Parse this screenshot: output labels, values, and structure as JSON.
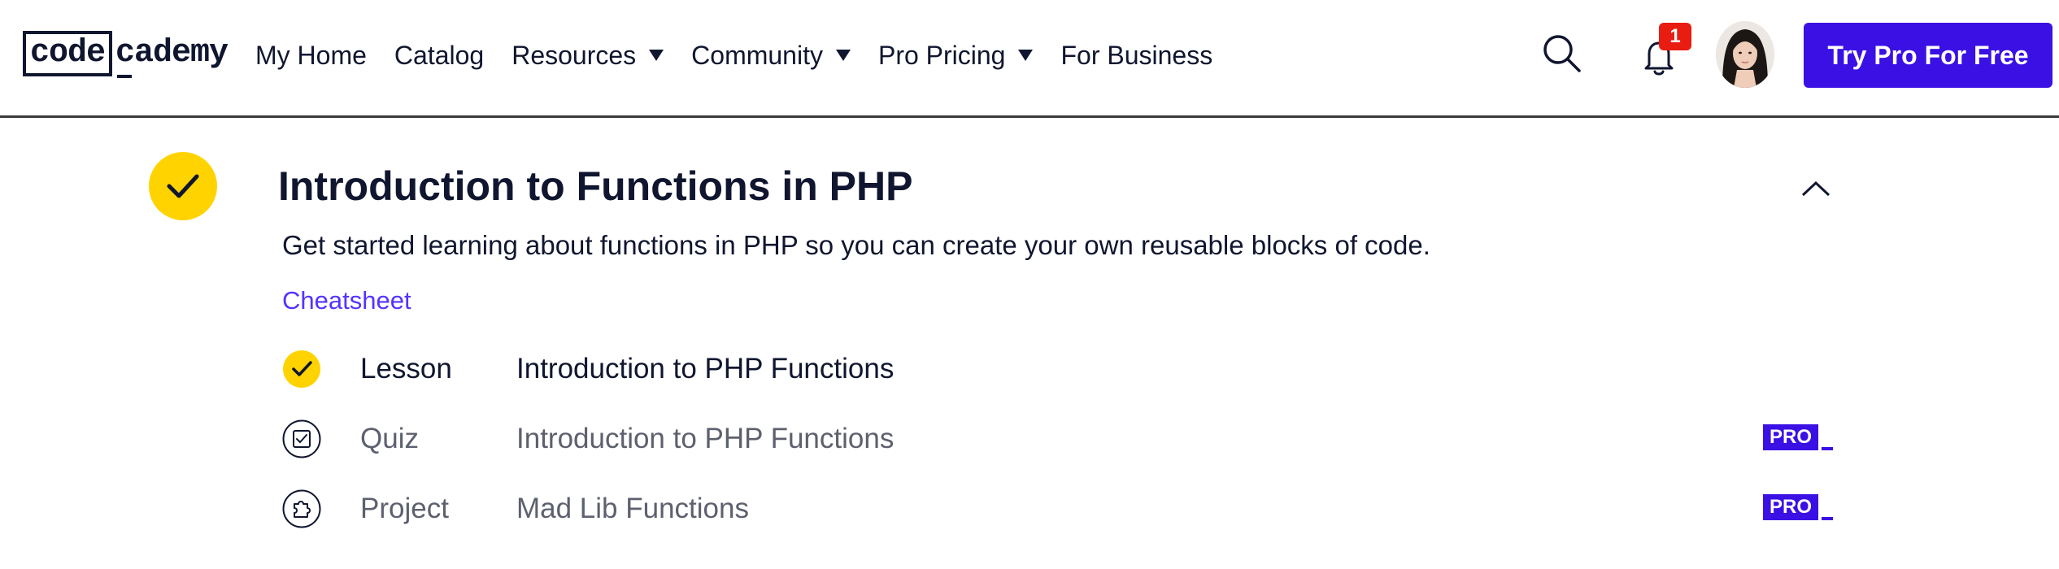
{
  "logo": {
    "part1": "code",
    "part2": "cademy"
  },
  "nav": {
    "items": [
      {
        "label": "My Home",
        "dropdown": false
      },
      {
        "label": "Catalog",
        "dropdown": false
      },
      {
        "label": "Resources",
        "dropdown": true
      },
      {
        "label": "Community",
        "dropdown": true
      },
      {
        "label": "Pro Pricing",
        "dropdown": true
      },
      {
        "label": "For Business",
        "dropdown": false
      }
    ]
  },
  "header": {
    "notification_count": "1",
    "cta_label": "Try Pro For Free"
  },
  "module": {
    "title": "Introduction to Functions in PHP",
    "description": "Get started learning about functions in PHP so you can create your own reusable blocks of code.",
    "cheatsheet_label": "Cheatsheet",
    "items": [
      {
        "type": "Lesson",
        "name": "Introduction to PHP Functions",
        "status": "complete",
        "icon": "check-icon",
        "pro": false
      },
      {
        "type": "Quiz",
        "name": "Introduction to PHP Functions",
        "status": "locked",
        "icon": "quiz-icon",
        "pro": true,
        "pro_label": "PRO"
      },
      {
        "type": "Project",
        "name": "Mad Lib Functions",
        "status": "locked",
        "icon": "puzzle-icon",
        "pro": true,
        "pro_label": "PRO"
      }
    ]
  },
  "colors": {
    "accent": "#3a10e5",
    "complete": "#ffd300",
    "link": "#5533ff",
    "badge": "#e91c11",
    "text": "#10162f"
  }
}
